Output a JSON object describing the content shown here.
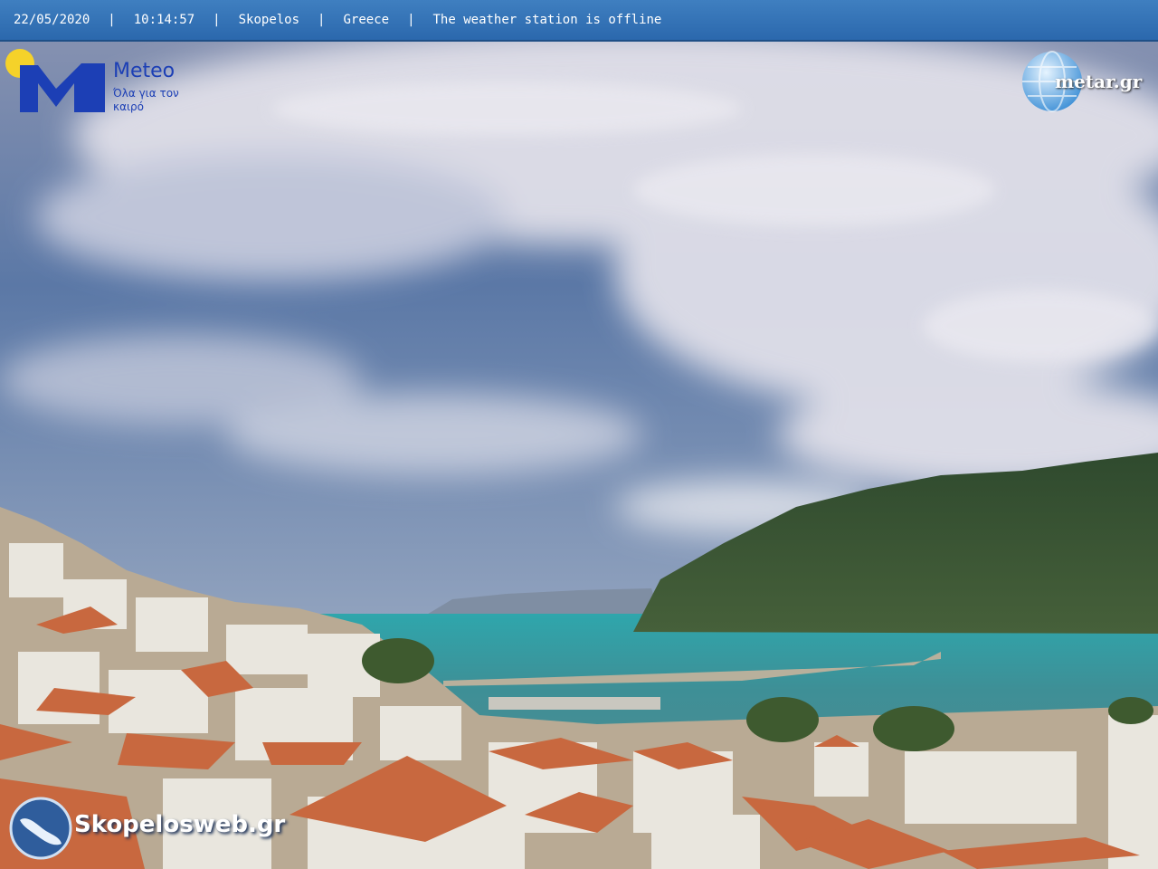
{
  "header": {
    "date": "22/05/2020",
    "time": "10:14:57",
    "location": "Skopelos",
    "country": "Greece",
    "status": "The weather station is offline",
    "separator": "|"
  },
  "logos": {
    "meteo": {
      "name": "Meteo",
      "tagline": "Όλα για τον καιρό"
    },
    "metar": {
      "name": "metar.gr"
    },
    "skopelos": {
      "name": "Skopelosweb.gr"
    }
  },
  "colors": {
    "header_bar": "#2b68ad",
    "meteo_blue": "#1c3fb5",
    "sun_yellow": "#f5d22a"
  }
}
